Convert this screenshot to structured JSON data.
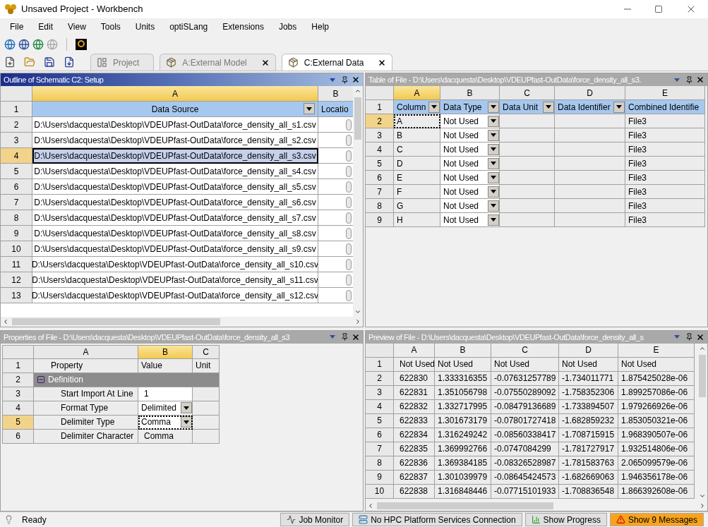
{
  "window": {
    "title": "Unsaved Project - Workbench"
  },
  "menu": [
    "File",
    "Edit",
    "View",
    "Tools",
    "Units",
    "optiSLang",
    "Extensions",
    "Jobs",
    "Help"
  ],
  "tabs": [
    {
      "label": "Project",
      "selected": false,
      "closable": false
    },
    {
      "label": "A:External Model",
      "selected": false,
      "closable": true
    },
    {
      "label": "C:External Data",
      "selected": true,
      "closable": true
    }
  ],
  "outline": {
    "title": "Outline of Schematic C2: Setup",
    "active": true,
    "columns": [
      {
        "letter": "A",
        "selected": true
      },
      {
        "letter": "B",
        "selected": false
      }
    ],
    "header": {
      "num": "1",
      "source": "Data Source",
      "location": "Locatio"
    },
    "rows": [
      {
        "num": "2",
        "source": "D:\\Users\\dacquesta\\Desktop\\VDEUPfast-OutData\\force_density_all_s1.csv",
        "selected": false
      },
      {
        "num": "3",
        "source": "D:\\Users\\dacquesta\\Desktop\\VDEUPfast-OutData\\force_density_all_s2.csv",
        "selected": false
      },
      {
        "num": "4",
        "source": "D:\\Users\\dacquesta\\Desktop\\VDEUPfast-OutData\\force_density_all_s3.csv",
        "selected": true
      },
      {
        "num": "5",
        "source": "D:\\Users\\dacquesta\\Desktop\\VDEUPfast-OutData\\force_density_all_s4.csv",
        "selected": false
      },
      {
        "num": "6",
        "source": "D:\\Users\\dacquesta\\Desktop\\VDEUPfast-OutData\\force_density_all_s5.csv",
        "selected": false
      },
      {
        "num": "7",
        "source": "D:\\Users\\dacquesta\\Desktop\\VDEUPfast-OutData\\force_density_all_s6.csv",
        "selected": false
      },
      {
        "num": "8",
        "source": "D:\\Users\\dacquesta\\Desktop\\VDEUPfast-OutData\\force_density_all_s7.csv",
        "selected": false
      },
      {
        "num": "9",
        "source": "D:\\Users\\dacquesta\\Desktop\\VDEUPfast-OutData\\force_density_all_s8.csv",
        "selected": false
      },
      {
        "num": "10",
        "source": "D:\\Users\\dacquesta\\Desktop\\VDEUPfast-OutData\\force_density_all_s9.csv",
        "selected": false
      },
      {
        "num": "11",
        "source": "D:\\Users\\dacquesta\\Desktop\\VDEUPfast-OutData\\force_density_all_s10.csv",
        "selected": false
      },
      {
        "num": "12",
        "source": "D:\\Users\\dacquesta\\Desktop\\VDEUPfast-OutData\\force_density_all_s11.csv",
        "selected": false
      },
      {
        "num": "13",
        "source": "D:\\Users\\dacquesta\\Desktop\\VDEUPfast-OutData\\force_density_all_s12.csv",
        "selected": false
      }
    ]
  },
  "table_of_file": {
    "title": "Table of File - D:\\Users\\dacquesta\\Desktop\\VDEUPfast-OutData\\force_density_all_s3.",
    "active": false,
    "columns": [
      {
        "letter": "A",
        "selected": true
      },
      {
        "letter": "B",
        "selected": false
      },
      {
        "letter": "C",
        "selected": false
      },
      {
        "letter": "D",
        "selected": false
      },
      {
        "letter": "E",
        "selected": false
      }
    ],
    "header": {
      "num": "1",
      "cells": [
        {
          "label": "Column",
          "filter": true
        },
        {
          "label": "Data Type",
          "filter": true
        },
        {
          "label": "Data Unit",
          "filter": true
        },
        {
          "label": "Data Identifier",
          "filter": true
        },
        {
          "label": "Combined Identifie",
          "filter": false
        }
      ]
    },
    "rows": [
      {
        "num": "2",
        "selected": true,
        "column": "A",
        "data_type": "Not Used",
        "combined": "File3"
      },
      {
        "num": "3",
        "selected": false,
        "column": "B",
        "data_type": "Not Used",
        "combined": "File3"
      },
      {
        "num": "4",
        "selected": false,
        "column": "C",
        "data_type": "Not Used",
        "combined": "File3"
      },
      {
        "num": "5",
        "selected": false,
        "column": "D",
        "data_type": "Not Used",
        "combined": "File3"
      },
      {
        "num": "6",
        "selected": false,
        "column": "E",
        "data_type": "Not Used",
        "combined": "File3"
      },
      {
        "num": "7",
        "selected": false,
        "column": "F",
        "data_type": "Not Used",
        "combined": "File3"
      },
      {
        "num": "8",
        "selected": false,
        "column": "G",
        "data_type": "Not Used",
        "combined": "File3"
      },
      {
        "num": "9",
        "selected": false,
        "column": "H",
        "data_type": "Not Used",
        "combined": "File3"
      }
    ]
  },
  "properties": {
    "title": "Properties of File - D:\\Users\\dacquesta\\Desktop\\VDEUPfast-OutData\\force_density_all_s3",
    "active": false,
    "columns": [
      {
        "letter": "A",
        "selected": false
      },
      {
        "letter": "B",
        "selected": true
      },
      {
        "letter": "C",
        "selected": false
      }
    ],
    "rows": [
      {
        "num": "1",
        "kind": "header",
        "property": "Property",
        "value": "Value",
        "unit": "Unit",
        "selected": false
      },
      {
        "num": "2",
        "kind": "group",
        "property": "Definition",
        "expanded": true,
        "selected": false
      },
      {
        "num": "3",
        "kind": "input",
        "property": "Start Import At Line",
        "value": "1",
        "selected": false
      },
      {
        "num": "4",
        "kind": "dropdown",
        "property": "Format Type",
        "value": "Delimited",
        "selected": false
      },
      {
        "num": "5",
        "kind": "dropdown",
        "property": "Delimiter Type",
        "value": "Comma",
        "selected": true
      },
      {
        "num": "6",
        "kind": "text",
        "property": "Delimiter Character",
        "value": "Comma",
        "selected": false
      }
    ]
  },
  "preview": {
    "title": "Preview of File - D:\\Users\\dacquesta\\Desktop\\VDEUPfast-OutData\\force_density_all_s",
    "active": false,
    "columns": [
      "A",
      "B",
      "C",
      "D",
      "E"
    ],
    "rows": [
      {
        "num": "1",
        "cells": [
          "Not Used",
          "Not Used",
          "Not Used",
          "Not Used",
          "Not Used"
        ]
      },
      {
        "num": "2",
        "cells": [
          "622830",
          "1.333316355",
          "-0.07631257789",
          "-1.734011771",
          "1.875425028e-06"
        ]
      },
      {
        "num": "3",
        "cells": [
          "622831",
          "1.351056798",
          "-0.07550289092",
          "-1.758352306",
          "1.899257086e-06"
        ]
      },
      {
        "num": "4",
        "cells": [
          "622832",
          "1.332717995",
          "-0.08479136689",
          "-1.733894507",
          "1.979266926e-06"
        ]
      },
      {
        "num": "5",
        "cells": [
          "622833",
          "1.301673179",
          "-0.07801727418",
          "-1.682859232",
          "1.853050321e-06"
        ]
      },
      {
        "num": "6",
        "cells": [
          "622834",
          "1.316249242",
          "-0.08560338417",
          "-1.708715915",
          "1.968390507e-06"
        ]
      },
      {
        "num": "7",
        "cells": [
          "622835",
          "1.369992766",
          "-0.0747084299",
          "-1.781727917",
          "1.932514806e-06"
        ]
      },
      {
        "num": "8",
        "cells": [
          "622836",
          "1.369384185",
          "-0.08326528987",
          "-1.781583763",
          "2.065099579e-06"
        ]
      },
      {
        "num": "9",
        "cells": [
          "622837",
          "1.301039979",
          "-0.08645424573",
          "-1.682669063",
          "1.946356178e-06"
        ]
      },
      {
        "num": "10",
        "cells": [
          "622838",
          "1.316848446",
          "-0.07715101933",
          "-1.708836548",
          "1.866392608e-06"
        ]
      }
    ]
  },
  "status": {
    "text": "Ready",
    "buttons": [
      {
        "label": "Job Monitor",
        "kind": "monitor"
      },
      {
        "label": "No HPC Platform Services Connection",
        "kind": "hpc"
      },
      {
        "label": "Show Progress",
        "kind": "progress"
      },
      {
        "label": "Show 9 Messages",
        "kind": "warning"
      }
    ]
  }
}
